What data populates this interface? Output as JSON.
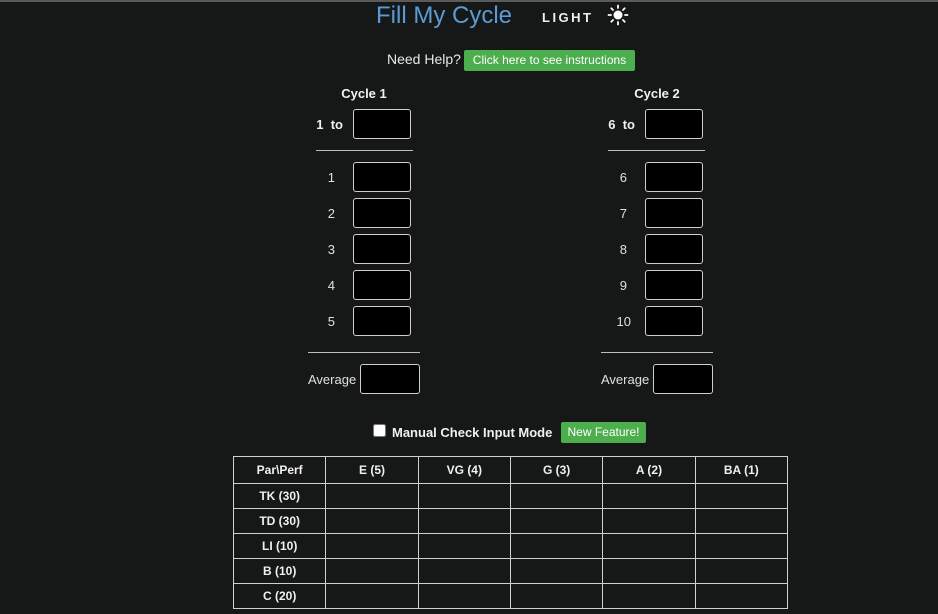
{
  "header": {
    "title": "Fill My Cycle",
    "mode_label": "LIGHT",
    "mode_icon": "sun-icon"
  },
  "help": {
    "label": "Need Help?",
    "button_label": "Click here to see instructions"
  },
  "colors": {
    "accent": "#5b9bd5",
    "button_green": "#4cae4c",
    "background": "#161817"
  },
  "cycles": [
    {
      "title": "Cycle 1",
      "range_start": "1",
      "range_word": "to",
      "range_value": "",
      "numbers": [
        "1",
        "2",
        "3",
        "4",
        "5"
      ],
      "values": [
        "",
        "",
        "",
        "",
        ""
      ],
      "average_label": "Average",
      "average_value": ""
    },
    {
      "title": "Cycle 2",
      "range_start": "6",
      "range_word": "to",
      "range_value": "",
      "numbers": [
        "6",
        "7",
        "8",
        "9",
        "10"
      ],
      "values": [
        "",
        "",
        "",
        "",
        ""
      ],
      "average_label": "Average",
      "average_value": ""
    }
  ],
  "manual": {
    "label": "Manual Check Input Mode",
    "checked": false,
    "feature_button": "New Feature!"
  },
  "table": {
    "columns": [
      "Par\\Perf",
      "E (5)",
      "VG (4)",
      "G (3)",
      "A (2)",
      "BA (1)"
    ],
    "rows": [
      {
        "label": "TK (30)",
        "cells": [
          "",
          "",
          "",
          "",
          ""
        ]
      },
      {
        "label": "TD (30)",
        "cells": [
          "",
          "",
          "",
          "",
          ""
        ]
      },
      {
        "label": "LI (10)",
        "cells": [
          "",
          "",
          "",
          "",
          ""
        ]
      },
      {
        "label": "B (10)",
        "cells": [
          "",
          "",
          "",
          "",
          ""
        ]
      },
      {
        "label": "C (20)",
        "cells": [
          "",
          "",
          "",
          "",
          ""
        ]
      }
    ]
  }
}
